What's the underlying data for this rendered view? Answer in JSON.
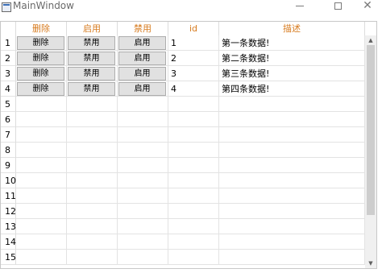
{
  "window": {
    "title": "MainWindow"
  },
  "table": {
    "headers": [
      "删除",
      "启用",
      "禁用",
      "id",
      "描述"
    ],
    "rows": [
      {
        "num": "1",
        "b1": "删除",
        "b2": "禁用",
        "b3": "启用",
        "id": "1",
        "desc": "第一条数据!"
      },
      {
        "num": "2",
        "b1": "删除",
        "b2": "禁用",
        "b3": "启用",
        "id": "2",
        "desc": "第二条数据!"
      },
      {
        "num": "3",
        "b1": "删除",
        "b2": "禁用",
        "b3": "启用",
        "id": "3",
        "desc": "第三条数据!"
      },
      {
        "num": "4",
        "b1": "删除",
        "b2": "禁用",
        "b3": "启用",
        "id": "4",
        "desc": "第四条数据!"
      }
    ],
    "empty_row_numbers": [
      "5",
      "6",
      "7",
      "8",
      "9",
      "10",
      "11",
      "12",
      "13",
      "14",
      "15"
    ]
  },
  "icons": {
    "app": "window-app-icon",
    "minimize": "minimize-icon",
    "maximize": "maximize-icon",
    "close": "close-icon",
    "scroll_up": "arrow-up-icon",
    "scroll_down": "arrow-down-icon"
  },
  "colors": {
    "header_text": "#d77b1f",
    "button_bg": "#e1e1e1",
    "scroll_thumb": "#cdcdcd"
  }
}
